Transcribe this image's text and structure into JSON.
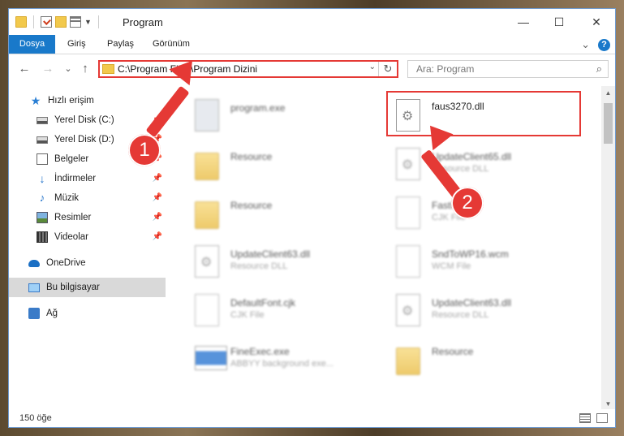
{
  "window": {
    "title": "Program",
    "minimize": "—",
    "maximize": "☐",
    "close": "✕"
  },
  "ribbon": {
    "tabs": [
      "Dosya",
      "Giriş",
      "Paylaş",
      "Görünüm"
    ],
    "expand": "⌄",
    "help": "?"
  },
  "address": {
    "path": "C:\\Program Files\\Program Dizini",
    "back": "←",
    "forward": "→",
    "recent": "⌄",
    "up": "↑",
    "dropdown": "⌄",
    "refresh": "↻"
  },
  "search": {
    "placeholder": "Ara: Program",
    "icon": "search-icon"
  },
  "nav": {
    "items": [
      {
        "label": "Hızlı erişim",
        "icon": "star-icon"
      },
      {
        "label": "Yerel Disk (C:)",
        "icon": "disk-icon"
      },
      {
        "label": "Yerel Disk (D:)",
        "icon": "disk-icon"
      },
      {
        "label": "Belgeler",
        "icon": "documents-icon"
      },
      {
        "label": "İndirmeler",
        "icon": "downloads-icon"
      },
      {
        "label": "Müzik",
        "icon": "music-icon"
      },
      {
        "label": "Resimler",
        "icon": "pictures-icon"
      },
      {
        "label": "Videolar",
        "icon": "videos-icon"
      },
      {
        "label": "OneDrive",
        "icon": "cloud-icon"
      },
      {
        "label": "Bu bilgisayar",
        "icon": "computer-icon"
      },
      {
        "label": "Ağ",
        "icon": "network-icon"
      }
    ],
    "pin": "📌"
  },
  "files": [
    {
      "name": "program.exe",
      "sub": ""
    },
    {
      "name": "faus3270.dll",
      "sub": ""
    },
    {
      "name": "Resource",
      "sub": ""
    },
    {
      "name": "UpdateClient65.dll",
      "sub": "Resource DLL"
    },
    {
      "name": "Resource",
      "sub": ""
    },
    {
      "name": "FastKey.cjk",
      "sub": "CJK File"
    },
    {
      "name": "UpdateClient63.dll",
      "sub": "Resource DLL"
    },
    {
      "name": "SndToWP16.wcm",
      "sub": "WCM File"
    },
    {
      "name": "DefaultFont.cjk",
      "sub": "CJK File"
    },
    {
      "name": "UpdateClient63.dll",
      "sub": "Resource DLL"
    },
    {
      "name": "FineExec.exe",
      "sub": "ABBYY background exe..."
    },
    {
      "name": "Resource",
      "sub": ""
    }
  ],
  "status": {
    "count": "150 öğe"
  },
  "annotations": {
    "step1": "1",
    "step2": "2"
  },
  "colors": {
    "accent": "#1979ca",
    "highlight": "#e53935"
  }
}
